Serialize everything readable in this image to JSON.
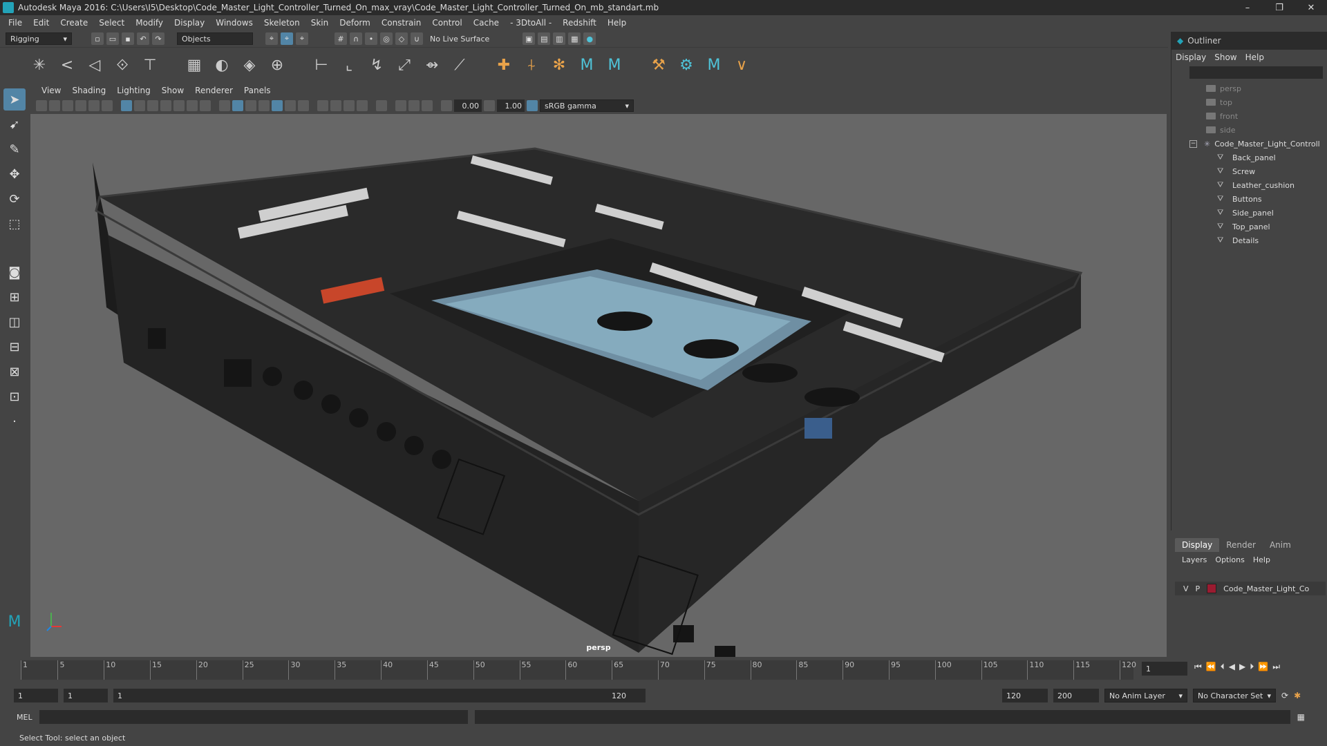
{
  "titlebar": {
    "title": "Autodesk Maya 2016: C:\\Users\\I5\\Desktop\\Code_Master_Light_Controller_Turned_On_max_vray\\Code_Master_Light_Controller_Turned_On_mb_standart.mb",
    "minimize": "–",
    "maximize": "❐",
    "close": "✕"
  },
  "menubar": [
    "File",
    "Edit",
    "Create",
    "Select",
    "Modify",
    "Display",
    "Windows",
    "Skeleton",
    "Skin",
    "Deform",
    "Constrain",
    "Control",
    "Cache",
    "- 3DtoAll -",
    "Redshift",
    "Help"
  ],
  "statusline": {
    "menuset": "Rigging",
    "objects_mode": "Objects",
    "live_surface": "No Live Surface"
  },
  "viewport": {
    "menu": [
      "View",
      "Shading",
      "Lighting",
      "Show",
      "Renderer",
      "Panels"
    ],
    "exposure": "0.00",
    "gamma": "1.00",
    "colorspace": "sRGB gamma",
    "camera": "persp"
  },
  "outliner": {
    "title": "Outliner",
    "menu": [
      "Display",
      "Show",
      "Help"
    ],
    "cameras": [
      "persp",
      "top",
      "front",
      "side"
    ],
    "group": "Code_Master_Light_Controll",
    "children": [
      "Back_panel",
      "Screw",
      "Leather_cushion",
      "Buttons",
      "Side_panel",
      "Top_panel",
      "Details"
    ]
  },
  "layers": {
    "tabs": [
      "Display",
      "Render",
      "Anim"
    ],
    "menu": [
      "Layers",
      "Options",
      "Help"
    ],
    "row": {
      "v": "V",
      "p": "P",
      "name": "Code_Master_Light_Co"
    },
    "swatch_color": "#9a1b30"
  },
  "timeline": {
    "ticks": [
      "1",
      "5",
      "10",
      "15",
      "20",
      "25",
      "30",
      "35",
      "40",
      "45",
      "50",
      "55",
      "60",
      "65",
      "70",
      "75",
      "80",
      "85",
      "90",
      "95",
      "100",
      "105",
      "110",
      "115",
      "120"
    ],
    "current_frame": "1"
  },
  "range": {
    "start": "1",
    "playback_start": "1",
    "slider_start": "1",
    "slider_end": "120",
    "playback_end": "120",
    "end": "200",
    "anim_layer": "No Anim Layer",
    "character_set": "No Character Set"
  },
  "cmd": {
    "label": "MEL"
  },
  "help": {
    "text": "Select Tool: select an object"
  },
  "colors": {
    "accent": "#5285a6",
    "maya_teal": "#23a3b8"
  }
}
